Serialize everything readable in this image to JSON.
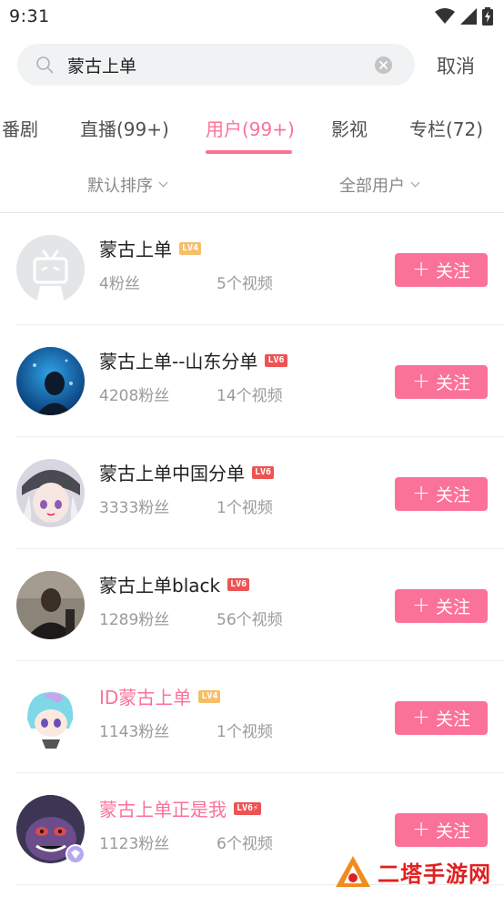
{
  "status_bar": {
    "time": "9:31"
  },
  "search": {
    "query": "蒙古上单",
    "cancel_label": "取消"
  },
  "tabs": [
    {
      "label": "番剧"
    },
    {
      "label": "直播(99+)"
    },
    {
      "label": "用户(99+)"
    },
    {
      "label": "影视"
    },
    {
      "label": "专栏(72)"
    }
  ],
  "active_tab": "用户(99+)",
  "filters": {
    "sort_label": "默认排序",
    "user_type_label": "全部用户"
  },
  "follow_label": "关注",
  "users": [
    {
      "name": "蒙古上单",
      "level": "LV4",
      "fans": "4粉丝",
      "videos": "5个视频"
    },
    {
      "name": "蒙古上单--山东分单",
      "level": "LV6",
      "fans": "4208粉丝",
      "videos": "14个视频"
    },
    {
      "name": "蒙古上单中国分单",
      "level": "LV6",
      "fans": "3333粉丝",
      "videos": "1个视频"
    },
    {
      "name": "蒙古上单black",
      "level": "LV6",
      "fans": "1289粉丝",
      "videos": "56个视频"
    },
    {
      "name": "ID蒙古上单",
      "level": "LV4",
      "fans": "1143粉丝",
      "videos": "1个视频"
    },
    {
      "name": "蒙古上单正是我",
      "level": "LV6⚡",
      "fans": "1123粉丝",
      "videos": "6个视频"
    }
  ],
  "colors": {
    "accent": "#fb7299",
    "lv4": "#f6be68",
    "lv6": "#ee5353"
  },
  "watermark": {
    "text": "二塔手游网"
  }
}
